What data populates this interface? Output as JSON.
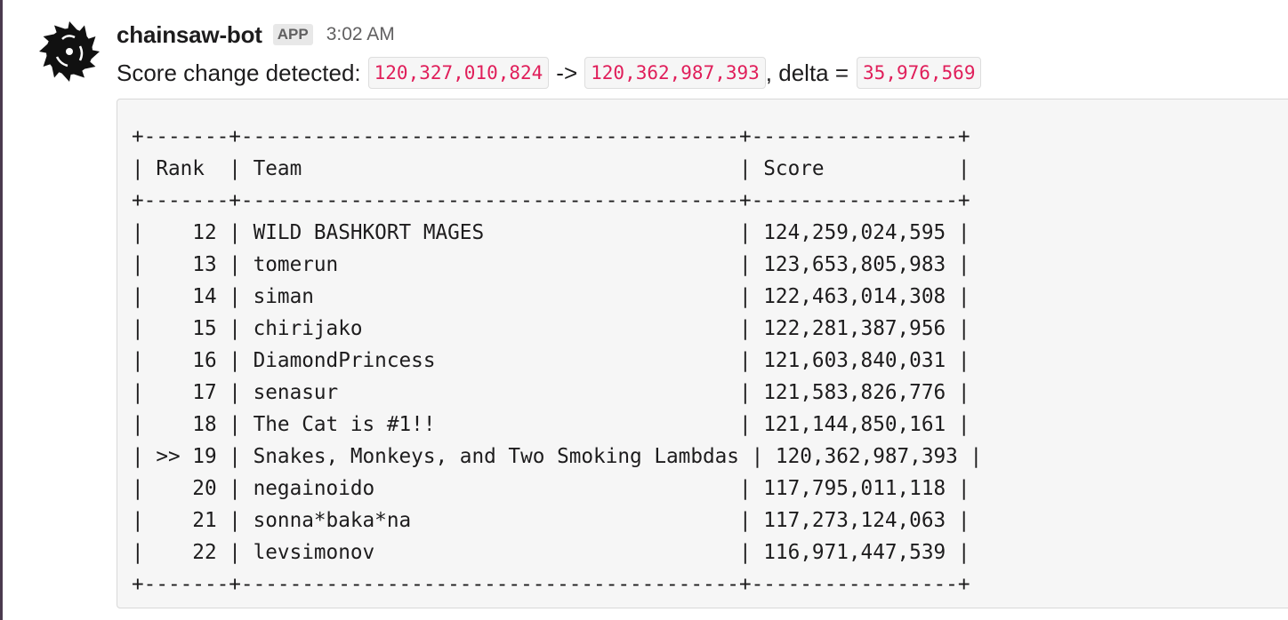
{
  "message": {
    "bot_name": "chainsaw-bot",
    "badge": "APP",
    "timestamp": "3:02 AM",
    "avatar_icon": "saw-blade-icon",
    "text_prefix": "Score change detected:",
    "old_score": "120,327,010,824",
    "arrow": "->",
    "new_score": "120,362,987,393",
    "delta_label": ", delta =",
    "delta": "35,976,569"
  },
  "table": {
    "lines": [
      "+-------+-----------------------------------------+-----------------+",
      "| Rank  | Team                                    | Score           |",
      "+-------+-----------------------------------------+-----------------+",
      "|    12 | WILD BASHKORT MAGES                     | 124,259,024,595 |",
      "|    13 | tomerun                                 | 123,653,805,983 |",
      "|    14 | siman                                   | 122,463,014,308 |",
      "|    15 | chirijako                               | 122,281,387,956 |",
      "|    16 | DiamondPrincess                         | 121,603,840,031 |",
      "|    17 | senasur                                 | 121,583,826,776 |",
      "|    18 | The Cat is #1!!                         | 121,144,850,161 |",
      "| >> 19 | Snakes, Monkeys, and Two Smoking Lambdas | 120,362,987,393 |",
      "|    20 | negainoido                              | 117,795,011,118 |",
      "|    21 | sonna*baka*na                           | 117,273,124,063 |",
      "|    22 | levsimonov                              | 116,971,447,539 |",
      "+-------+-----------------------------------------+-----------------+"
    ]
  },
  "colors": {
    "code_text": "#e01e5a",
    "code_bg": "#f6f6f6",
    "sidebar_accent": "#4a3a4e"
  }
}
